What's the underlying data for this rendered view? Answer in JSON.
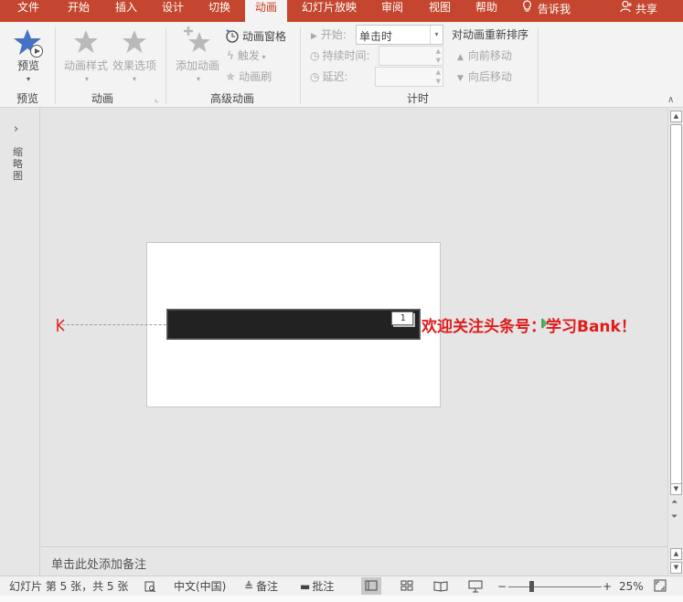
{
  "colors": {
    "accent": "#c5462f",
    "ribbon_bg": "#f3f3f3",
    "promo_text": "#e01a1a"
  },
  "menu": {
    "tabs": [
      "文件",
      "开始",
      "插入",
      "设计",
      "切换",
      "动画",
      "幻灯片放映",
      "审阅",
      "视图",
      "帮助"
    ],
    "active_tab": "动画",
    "tell_me": "告诉我",
    "share": "共享"
  },
  "ribbon": {
    "preview": {
      "button": "预览",
      "group": "预览"
    },
    "animation": {
      "style": "动画样式",
      "options": "效果选项",
      "group": "动画"
    },
    "advanced": {
      "add": "添加动画",
      "pane": "动画窗格",
      "trigger": "触发",
      "painter": "动画刷",
      "group": "高级动画"
    },
    "timing": {
      "start_label": "开始:",
      "start_value": "单击时",
      "duration_label": "持续时间:",
      "delay_label": "延迟:",
      "reorder": "对动画重新排序",
      "move_earlier": "向前移动",
      "move_later": "向后移动",
      "group": "计时"
    }
  },
  "thumbnail_pane": {
    "label": "缩略图"
  },
  "slide": {
    "animation_order": "1",
    "promo_text": "欢迎关注头条号：学习Bank！"
  },
  "notes": {
    "placeholder": "单击此处添加备注"
  },
  "status": {
    "slide_info": "幻灯片 第 5 张，共 5 张",
    "language": "中文(中国)",
    "notes_btn": "备注",
    "comments_btn": "批注",
    "zoom_out": "−",
    "zoom_in": "+",
    "zoom": "25%",
    "zoom_fraction": 0.25
  }
}
